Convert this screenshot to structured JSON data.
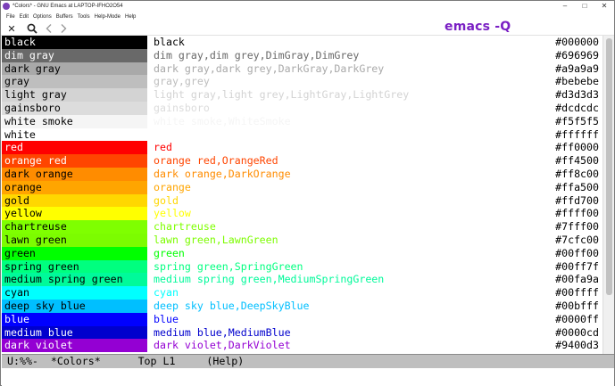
{
  "window": {
    "title": "*Colors* - GNU Emacs at LAPTOP-IFHO2O54"
  },
  "menubar": {
    "items": [
      "File",
      "Edit",
      "Options",
      "Buffers",
      "Tools",
      "Help-Mode",
      "Help"
    ]
  },
  "toolbar": {
    "icons": [
      "close-icon",
      "search-icon",
      "back-arrow-icon",
      "forward-arrow-icon"
    ]
  },
  "overlay_label": "emacs -Q",
  "colors": [
    {
      "swatch": "black",
      "names": "black",
      "hex": "#000000",
      "bg": "#000000",
      "fg": "#ffffff",
      "name_color": "#000000"
    },
    {
      "swatch": "dim gray",
      "names": "dim gray,dim grey,DimGray,DimGrey",
      "hex": "#696969",
      "bg": "#696969",
      "fg": "#ffffff",
      "name_color": "#696969"
    },
    {
      "swatch": "dark gray",
      "names": "dark gray,dark grey,DarkGray,DarkGrey",
      "hex": "#a9a9a9",
      "bg": "#a9a9a9",
      "fg": "#000000",
      "name_color": "#a9a9a9"
    },
    {
      "swatch": "gray",
      "names": "gray,grey",
      "hex": "#bebebe",
      "bg": "#bebebe",
      "fg": "#000000",
      "name_color": "#bebebe"
    },
    {
      "swatch": "light gray",
      "names": "light gray,light grey,LightGray,LightGrey",
      "hex": "#d3d3d3",
      "bg": "#d3d3d3",
      "fg": "#000000",
      "name_color": "#d3d3d3"
    },
    {
      "swatch": "gainsboro",
      "names": "gainsboro",
      "hex": "#dcdcdc",
      "bg": "#dcdcdc",
      "fg": "#000000",
      "name_color": "#dcdcdc"
    },
    {
      "swatch": "white smoke",
      "names": "white smoke,WhiteSmoke",
      "hex": "#f5f5f5",
      "bg": "#f5f5f5",
      "fg": "#000000",
      "name_color": "#f5f5f5"
    },
    {
      "swatch": "white",
      "names": "white",
      "hex": "#ffffff",
      "bg": "#ffffff",
      "fg": "#000000",
      "name_color": "#ffffff"
    },
    {
      "swatch": "red",
      "names": "red",
      "hex": "#ff0000",
      "bg": "#ff0000",
      "fg": "#ffffff",
      "name_color": "#ff0000"
    },
    {
      "swatch": "orange red",
      "names": "orange red,OrangeRed",
      "hex": "#ff4500",
      "bg": "#ff4500",
      "fg": "#ffffff",
      "name_color": "#ff4500"
    },
    {
      "swatch": "dark orange",
      "names": "dark orange,DarkOrange",
      "hex": "#ff8c00",
      "bg": "#ff8c00",
      "fg": "#000000",
      "name_color": "#ff8c00"
    },
    {
      "swatch": "orange",
      "names": "orange",
      "hex": "#ffa500",
      "bg": "#ffa500",
      "fg": "#000000",
      "name_color": "#ffa500"
    },
    {
      "swatch": "gold",
      "names": "gold",
      "hex": "#ffd700",
      "bg": "#ffd700",
      "fg": "#000000",
      "name_color": "#ffd700"
    },
    {
      "swatch": "yellow",
      "names": "yellow",
      "hex": "#ffff00",
      "bg": "#ffff00",
      "fg": "#000000",
      "name_color": "#ffff00"
    },
    {
      "swatch": "chartreuse",
      "names": "chartreuse",
      "hex": "#7fff00",
      "bg": "#7fff00",
      "fg": "#000000",
      "name_color": "#7fff00"
    },
    {
      "swatch": "lawn green",
      "names": "lawn green,LawnGreen",
      "hex": "#7cfc00",
      "bg": "#7cfc00",
      "fg": "#000000",
      "name_color": "#7cfc00"
    },
    {
      "swatch": "green",
      "names": "green",
      "hex": "#00ff00",
      "bg": "#00ff00",
      "fg": "#000000",
      "name_color": "#00ff00"
    },
    {
      "swatch": "spring green",
      "names": "spring green,SpringGreen",
      "hex": "#00ff7f",
      "bg": "#00ff7f",
      "fg": "#000000",
      "name_color": "#00ff7f"
    },
    {
      "swatch": "medium spring green",
      "names": "medium spring green,MediumSpringGreen",
      "hex": "#00fa9a",
      "bg": "#00fa9a",
      "fg": "#000000",
      "name_color": "#00fa9a"
    },
    {
      "swatch": "cyan",
      "names": "cyan",
      "hex": "#00ffff",
      "bg": "#00ffff",
      "fg": "#000000",
      "name_color": "#00ffff"
    },
    {
      "swatch": "deep sky blue",
      "names": "deep sky blue,DeepSkyBlue",
      "hex": "#00bfff",
      "bg": "#00bfff",
      "fg": "#000000",
      "name_color": "#00bfff"
    },
    {
      "swatch": "blue",
      "names": "blue",
      "hex": "#0000ff",
      "bg": "#0000ff",
      "fg": "#ffffff",
      "name_color": "#0000ff"
    },
    {
      "swatch": "medium blue",
      "names": "medium blue,MediumBlue",
      "hex": "#0000cd",
      "bg": "#0000cd",
      "fg": "#ffffff",
      "name_color": "#0000cd"
    },
    {
      "swatch": "dark violet",
      "names": "dark violet,DarkViolet",
      "hex": "#9400d3",
      "bg": "#9400d3",
      "fg": "#ffffff",
      "name_color": "#9400d3"
    }
  ],
  "modeline": {
    "text": "U:%%-  *Colors*      Top L1     (Help)"
  }
}
